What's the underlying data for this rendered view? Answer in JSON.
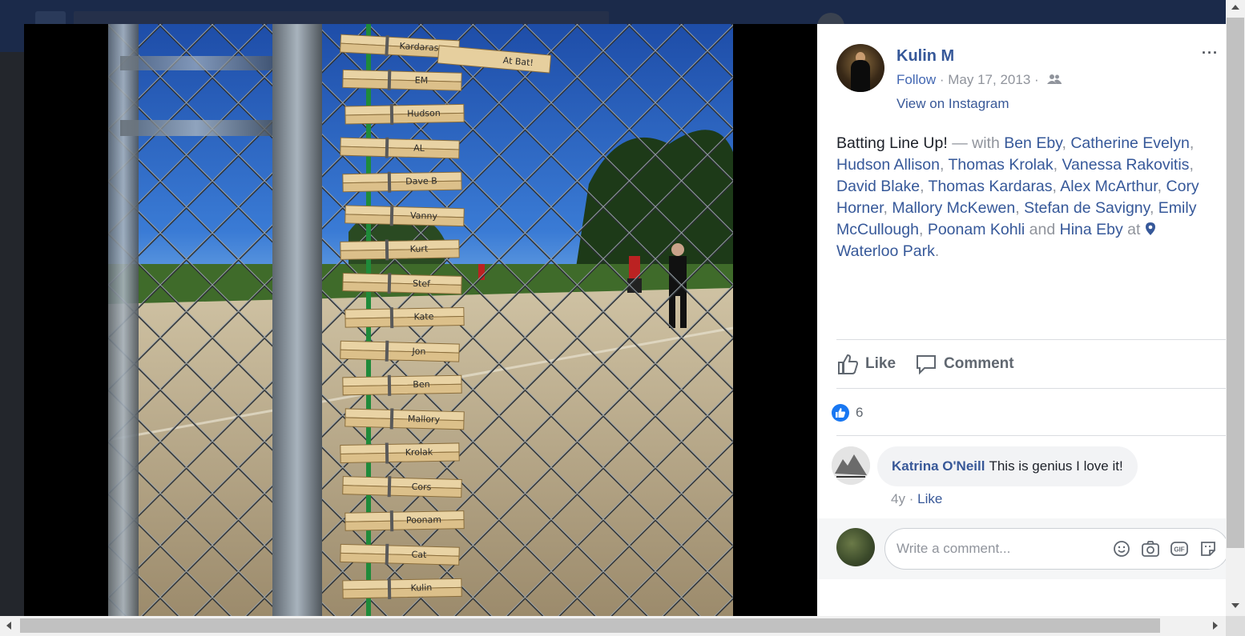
{
  "post": {
    "author": "Kulin M",
    "follow": "Follow",
    "separator": "·",
    "date": "May 17, 2013",
    "view_on": "View on Instagram",
    "more": "···"
  },
  "caption": {
    "lines": [
      [
        {
          "t": "Batting Line Up! ",
          "c": "text"
        },
        {
          "t": "— with ",
          "c": "dim"
        },
        {
          "t": "Ben Eby",
          "c": "link"
        },
        {
          "t": ", ",
          "c": "dim"
        },
        {
          "t": "Catherine Evelyn",
          "c": "link"
        },
        {
          "t": ",",
          "c": "dim"
        }
      ],
      [
        {
          "t": "Hudson Allison",
          "c": "link"
        },
        {
          "t": ", ",
          "c": "dim"
        },
        {
          "t": "Thomas Krolak",
          "c": "link"
        },
        {
          "t": ", ",
          "c": "dim"
        },
        {
          "t": "Vanessa Rakovitis",
          "c": "link"
        },
        {
          "t": ",",
          "c": "dim"
        }
      ],
      [
        {
          "t": "David Blake",
          "c": "link"
        },
        {
          "t": ", ",
          "c": "dim"
        },
        {
          "t": "Thomas Kardaras",
          "c": "link"
        },
        {
          "t": ", ",
          "c": "dim"
        },
        {
          "t": "Alex McArthur",
          "c": "link"
        },
        {
          "t": ", ",
          "c": "dim"
        },
        {
          "t": "Cory",
          "c": "link"
        }
      ],
      [
        {
          "t": "Horner",
          "c": "link"
        },
        {
          "t": ", ",
          "c": "dim"
        },
        {
          "t": "Mallory McKewen",
          "c": "link"
        },
        {
          "t": ", ",
          "c": "dim"
        },
        {
          "t": "Stefan de Savigny",
          "c": "link"
        },
        {
          "t": ", ",
          "c": "dim"
        },
        {
          "t": "Emily",
          "c": "link"
        }
      ],
      [
        {
          "t": "McCullough",
          "c": "link"
        },
        {
          "t": ", ",
          "c": "dim"
        },
        {
          "t": "Poonam Kohli",
          "c": "link"
        },
        {
          "t": " and ",
          "c": "dim"
        },
        {
          "t": "Hina Eby",
          "c": "link"
        },
        {
          "t": " at ",
          "c": "dim"
        },
        {
          "t": "pin",
          "c": "pin"
        }
      ],
      [
        {
          "t": "Waterloo Park",
          "c": "link"
        },
        {
          "t": ".",
          "c": "dim"
        }
      ]
    ]
  },
  "actions": {
    "like": "Like",
    "comment": "Comment"
  },
  "reactions": {
    "count": "6"
  },
  "comments": [
    {
      "name": "Katrina O'Neill",
      "text": "This is genius I love it!",
      "age": "4y",
      "like": "Like"
    }
  ],
  "composer": {
    "placeholder": "Write a comment...",
    "gif": "GIF"
  },
  "photo": {
    "clothespins": [
      "Kardaras",
      "EM",
      "Hudson",
      "AL",
      "Dave B",
      "Vanny",
      "Kurt",
      "Stef",
      "Kate",
      "Jon",
      "Ben",
      "Mallory",
      "Krolak",
      "Cors",
      "Poonam",
      "Cat",
      "Kulin"
    ],
    "extra_pin": "At Bat!"
  },
  "colors": {
    "link": "#365899",
    "muted": "#90949c",
    "like_blue": "#1877f2"
  }
}
